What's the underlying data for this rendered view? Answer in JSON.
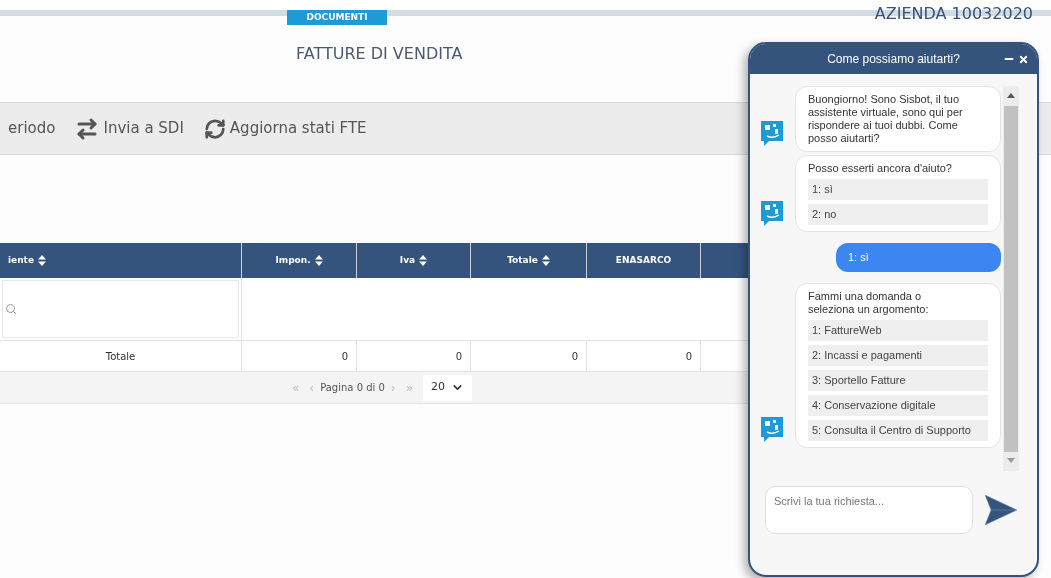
{
  "top_tab": {
    "label": "DOCUMENTI",
    "selected": true
  },
  "company": "AZIENDA 10032020",
  "page_title": "FATTURE DI VENDITA",
  "toolbar": [
    {
      "label": "eriodo"
    },
    {
      "label": "Invia a SDI"
    },
    {
      "label": "Aggiorna stati FTE"
    }
  ],
  "table": {
    "columns": [
      {
        "label": "iente",
        "sortable": true
      },
      {
        "label": "Impon.",
        "sortable": true
      },
      {
        "label": "Iva",
        "sortable": true
      },
      {
        "label": "Totale",
        "sortable": true
      },
      {
        "label": "ENASARCO",
        "sortable": false
      }
    ],
    "totals_row": [
      "Totale",
      "0",
      "0",
      "0",
      "0"
    ]
  },
  "pagination": {
    "first": "«",
    "prev": "‹",
    "label": "Pagina 0 di 0",
    "next": "›",
    "last": "»",
    "page_size": "20"
  },
  "chat": {
    "title": "Come possiamo aiutarti?",
    "messages": [
      {
        "kind": "bot",
        "text": "Buongiorno! Sono Sisbot, il tuo assistente virtuale, sono qui per rispondere ai tuoi dubbi. Come posso aiutarti?"
      },
      {
        "kind": "bot",
        "text": "Posso esserti ancora d'aiuto?",
        "options": [
          "1: sì",
          "2: no"
        ]
      },
      {
        "kind": "user",
        "text": "1: sì"
      },
      {
        "kind": "bot",
        "text": "Fammi una domanda o seleziona un argomento:",
        "options": [
          "1: FattureWeb",
          "2: Incassi e pagamenti",
          "3: Sportello Fatture",
          "4: Conservazione digitale",
          "5: Consulta il Centro di Supporto"
        ]
      }
    ],
    "input_placeholder": "Scrivi la tua richiesta..."
  }
}
